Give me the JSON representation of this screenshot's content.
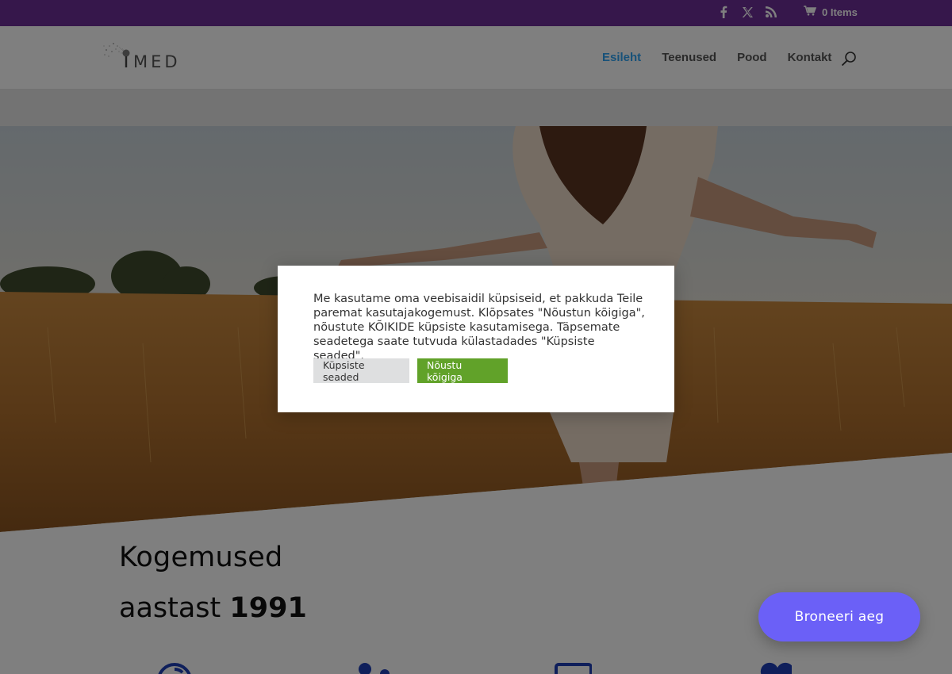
{
  "topbar": {
    "social": [
      "facebook-icon",
      "x-icon",
      "rss-icon"
    ],
    "cart_label": "0 Items"
  },
  "header": {
    "logo_text": "MED",
    "nav": [
      {
        "label": "Esileht",
        "active": true
      },
      {
        "label": "Teenused",
        "active": false
      },
      {
        "label": "Pood",
        "active": false
      },
      {
        "label": "Kontakt",
        "active": false
      }
    ]
  },
  "section": {
    "heading_line1": "Kogemused",
    "heading_line2_prefix": "aastast ",
    "heading_line2_bold": "1991"
  },
  "cookie": {
    "message": "Me kasutame oma veebisaidil küpsiseid, et pakkuda Teile paremat kasutajakogemust. Klõpsates \"Nõustun kõigiga\", nõustute KÕIKIDE küpsiste kasutamisega. Täpsemate seadetega saate tutvuda külastadades \"Küpsiste seaded\".",
    "settings_label": "Küpsiste seaded",
    "accept_label": "Nõustu kõigiga"
  },
  "book_button": "Broneeri aeg",
  "colors": {
    "topbar": "#6c2e96",
    "nav_active": "#2ea3f2",
    "accept": "#61a229",
    "book": "#6b60f7"
  }
}
